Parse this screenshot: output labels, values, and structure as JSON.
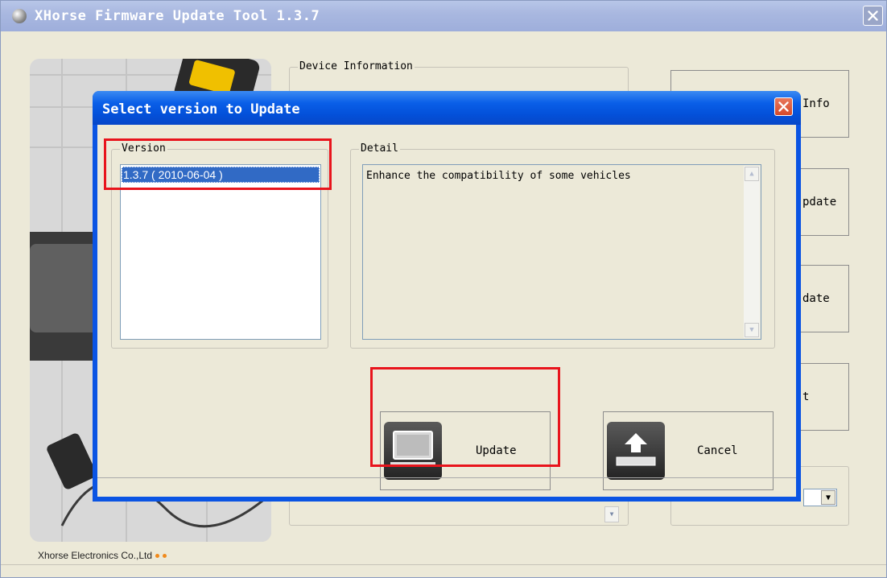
{
  "main_window": {
    "title": "XHorse Firmware Update Tool 1.3.7",
    "company": "Xhorse Electronics Co.,Ltd",
    "device_info_label": "Device Information",
    "right_buttons": [
      "Info",
      "pdate",
      "date",
      "t"
    ]
  },
  "dialog": {
    "title": "Select version to Update",
    "version_group_label": "Version",
    "versions": [
      {
        "label": "1.3.7    ( 2010-06-04 )",
        "selected": true
      }
    ],
    "detail_group_label": "Detail",
    "detail_text": "Enhance the compatibility of some vehicles",
    "update_label": "Update",
    "cancel_label": "Cancel"
  },
  "icons": {
    "title": "xhorse-logo-icon",
    "close": "close-icon",
    "update": "computer-icon",
    "cancel": "eject-icon"
  },
  "colors": {
    "highlight": "#e8141c",
    "dialog_titlebar": "#0a54e3",
    "selection": "#316ac5"
  }
}
